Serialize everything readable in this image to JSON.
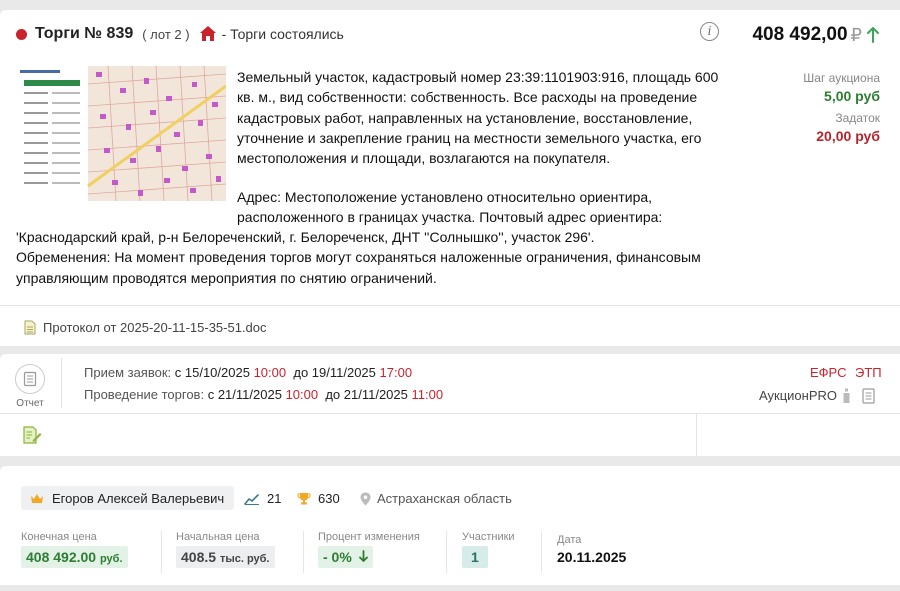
{
  "lot": {
    "title": "Торги № 839",
    "lot_label": "( лот 2 )",
    "status": "- Торги состоялись",
    "price": "408 492,00",
    "currency_sign": "₽",
    "step_label": "Шаг аукциона",
    "step_value": "5,00 руб",
    "deposit_label": "Задаток",
    "deposit_value": "20,00 руб",
    "description": "Земельный участок, кадастровый номер 23:39:1101903:916, площадь 600 кв. м., вид собственности: собственность. Все расходы на проведение кадастровых работ, направленных на установление, восстановление, уточнение и закрепление границ на местности земельного участка, его местоположения и площади, возлагаются на покупателя.",
    "address_line": "Адрес: Местоположение установлено относительно ориентира, расположенного в границах участка. Почтовый адрес ориентира:",
    "address_tail": "'Краснодарский край, р-н Белореченский, г. Белореченск, ДНТ ''Солнышко'', участок 296'.",
    "encumbrance": "Обременения: На момент проведения торгов могут сохраняться наложенные ограничения, финансовым управляющим проводятся мероприятия по снятию ограничений.",
    "document": "Протокол от 2025-20-11-15-35-51.doc"
  },
  "schedule": {
    "report_label": "Отчет",
    "applications_label": "Прием заявок:",
    "applications_from": "с 15/10/2025",
    "applications_from_time": "10:00",
    "applications_to": "до 19/11/2025",
    "applications_to_time": "17:00",
    "trading_label": "Проведение торгов:",
    "trading_from": "с 21/11/2025",
    "trading_from_time": "10:00",
    "trading_to": "до 21/11/2025",
    "trading_to_time": "11:00",
    "tag_efrs": "ЕФРС",
    "tag_etp": "ЭТП",
    "platform": "АукционPRO"
  },
  "result": {
    "winner": "Егоров Алексей Валерьевич",
    "stat_chart": "21",
    "stat_trophy": "630",
    "region": "Астраханская область",
    "final_price_label": "Конечная цена",
    "final_price": "408 492.00",
    "final_price_unit": "руб.",
    "start_price_label": "Начальная цена",
    "start_price": "408.5",
    "start_price_unit": "тыс. руб.",
    "change_label": "Процент изменения",
    "change_value": "- 0%",
    "participants_label": "Участники",
    "participants_value": "1",
    "date_label": "Дата",
    "date_value": "20.11.2025"
  },
  "colors": {
    "accent_red": "#c9232d",
    "green": "#2e7d32"
  }
}
